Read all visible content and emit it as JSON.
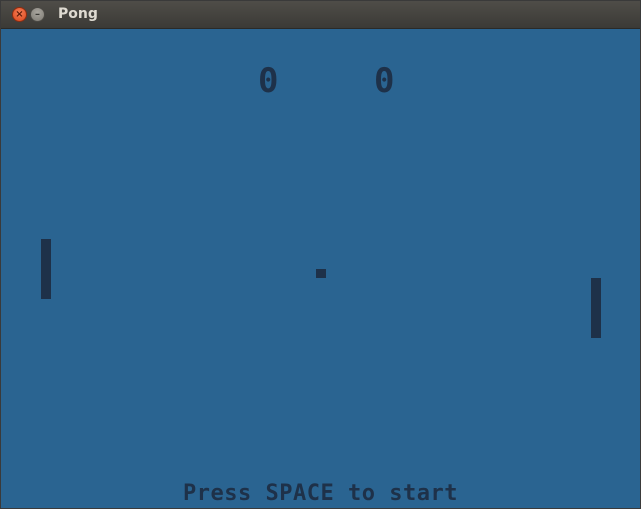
{
  "window": {
    "title": "Pong",
    "close_glyph": "×",
    "minimize_glyph": "–",
    "close_icon": "close-icon",
    "minimize_icon": "minimize-icon"
  },
  "game": {
    "score_left": "0",
    "score_right": "0",
    "prompt": "Press SPACE to start",
    "colors": {
      "background": "#2a6491",
      "foreground": "#1e3149"
    }
  }
}
